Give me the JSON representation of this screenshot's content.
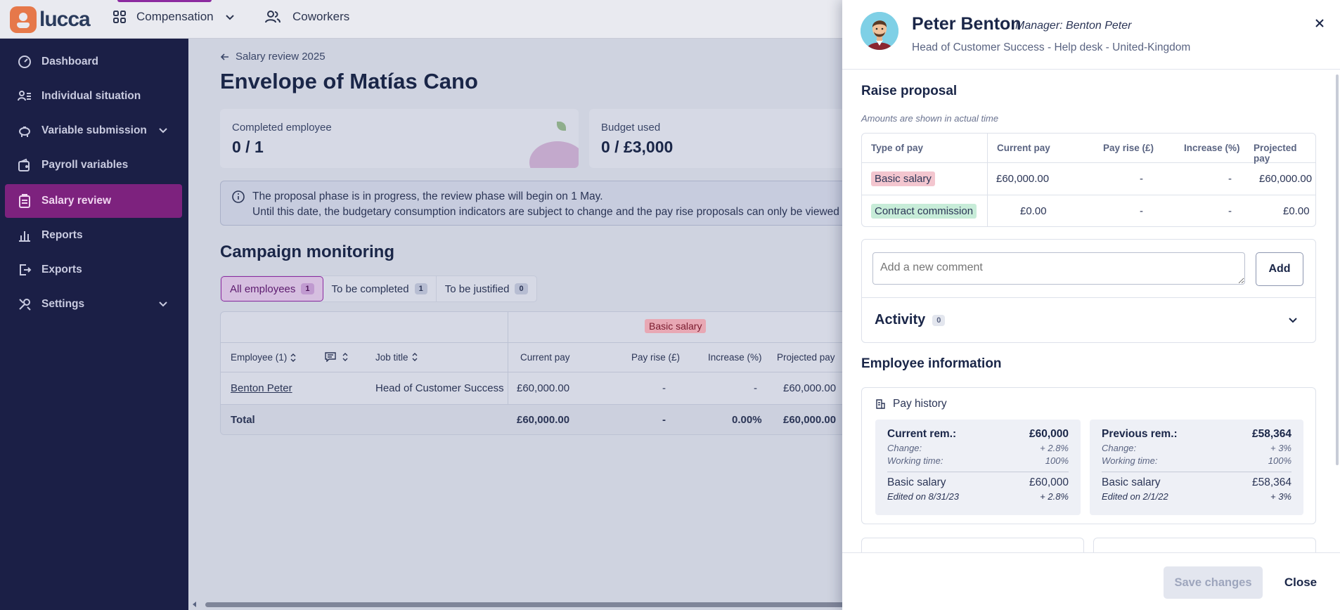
{
  "app": {
    "name": "lucca"
  },
  "topnav": {
    "compensation": "Compensation",
    "coworkers": "Coworkers"
  },
  "sidebar": {
    "items": [
      {
        "label": "Dashboard",
        "icon": "gauge-icon"
      },
      {
        "label": "Individual situation",
        "icon": "person-list-icon"
      },
      {
        "label": "Variable submission",
        "icon": "piggy-bank-icon",
        "expandable": true
      },
      {
        "label": "Payroll variables",
        "icon": "wallet-icon"
      },
      {
        "label": "Salary review",
        "icon": "clipboard-icon",
        "active": true
      },
      {
        "label": "Reports",
        "icon": "bar-chart-icon"
      },
      {
        "label": "Exports",
        "icon": "export-icon"
      },
      {
        "label": "Settings",
        "icon": "tools-icon",
        "expandable": true
      }
    ]
  },
  "main": {
    "breadcrumb": "Salary review 2025",
    "title": "Envelope of Matías Cano",
    "cards": [
      {
        "label": "Completed employee",
        "value": "0 / 1"
      },
      {
        "label": "Budget used",
        "value": "0 / £3,000"
      }
    ],
    "notice": {
      "line1": "The proposal phase is in progress, the review phase will begin on 1 May.",
      "line2": "Until this date, the budgetary consumption indicators are subject to change and the pay rise proposals can only be viewed in read"
    },
    "section_title": "Campaign monitoring",
    "filters": [
      {
        "label": "All employees",
        "count": "1",
        "active": true
      },
      {
        "label": "To be completed",
        "count": "1"
      },
      {
        "label": "To be justified",
        "count": "0"
      }
    ],
    "table": {
      "group_header": "Basic salary",
      "headers": {
        "employee": "Employee (1)",
        "job_title": "Job title",
        "current_pay": "Current pay",
        "pay_rise": "Pay rise (£)",
        "increase": "Increase (%)",
        "projected_pay": "Projected pay"
      },
      "rows": [
        {
          "employee": "Benton Peter",
          "job_title": "Head of Customer Success",
          "current_pay": "£60,000.00",
          "pay_rise": "-",
          "increase": "-",
          "projected_pay": "£60,000.00"
        }
      ],
      "total": {
        "label": "Total",
        "current_pay": "£60,000.00",
        "pay_rise": "-",
        "increase": "0.00%",
        "projected_pay": "£60,000.00"
      }
    }
  },
  "drawer": {
    "name": "Peter Benton",
    "manager": "Manager: Benton Peter",
    "subtitle": "Head of Customer Success - Help desk - United-Kingdom",
    "raise": {
      "title": "Raise proposal",
      "note": "Amounts are shown in actual time",
      "headers": [
        "Type of pay",
        "Current pay",
        "Pay rise (£)",
        "Increase (%)",
        "Projected pay"
      ],
      "rows": [
        {
          "type": "Basic salary",
          "current": "£60,000.00",
          "rise": "-",
          "increase": "-",
          "projected": "£60,000.00"
        },
        {
          "type": "Contract commission",
          "current": "£0.00",
          "rise": "-",
          "increase": "-",
          "projected": "£0.00"
        }
      ]
    },
    "comment": {
      "placeholder": "Add a new comment",
      "add_label": "Add"
    },
    "activity": {
      "label": "Activity",
      "count": "0"
    },
    "employee_info": {
      "title": "Employee information",
      "pay_history": {
        "title": "Pay history",
        "current": {
          "label": "Current rem.:",
          "value": "£60,000",
          "change_label": "Change:",
          "change": "+ 2.8%",
          "time_label": "Working time:",
          "time": "100%",
          "item_label": "Basic salary",
          "item_value": "£60,000",
          "edited": "Edited on 8/31/23",
          "edited_change": "+ 2.8%"
        },
        "previous": {
          "label": "Previous rem.:",
          "value": "£58,364",
          "change_label": "Change:",
          "change": "+ 3%",
          "time_label": "Working time:",
          "time": "100%",
          "item_label": "Basic salary",
          "item_value": "£58,364",
          "edited": "Edited on 2/1/22",
          "edited_change": "+ 3%"
        }
      }
    },
    "footer": {
      "save": "Save changes",
      "close": "Close"
    }
  }
}
